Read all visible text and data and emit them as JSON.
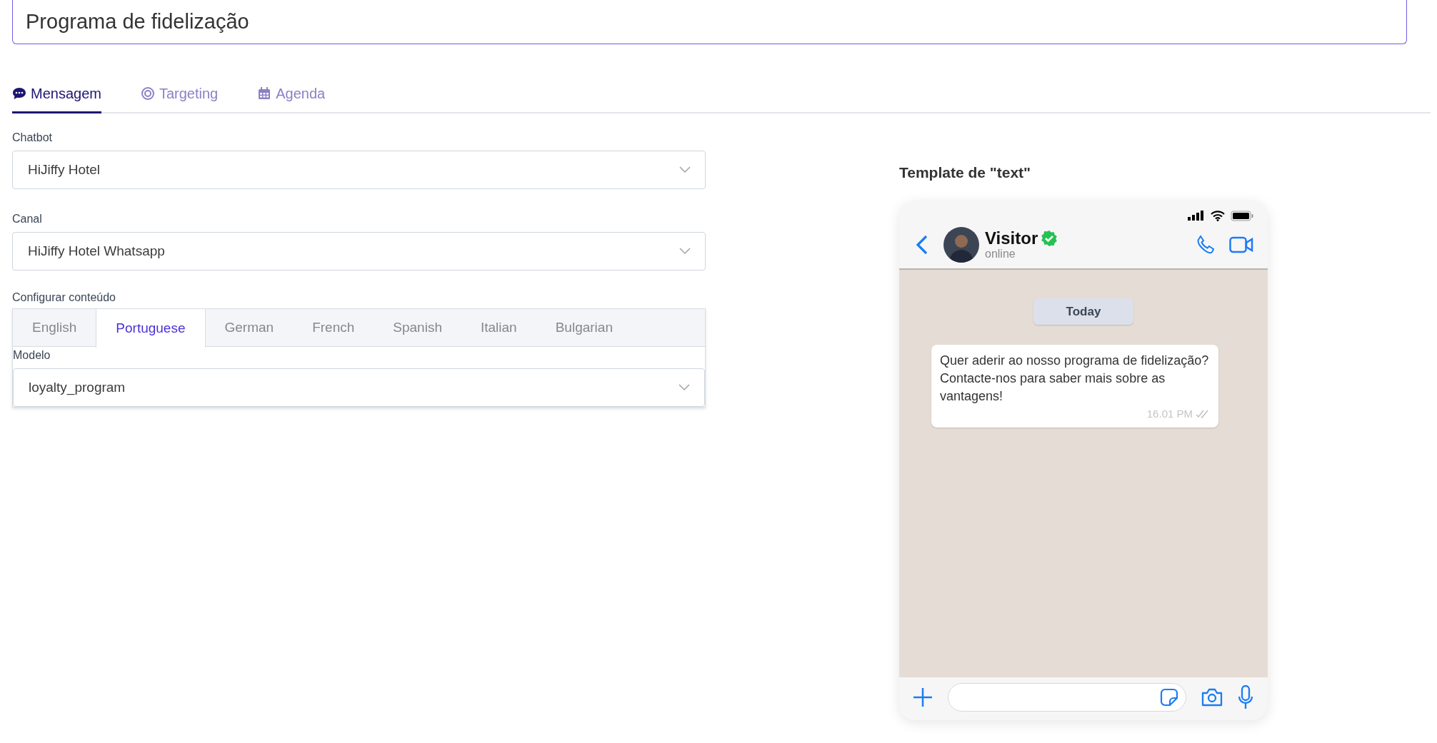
{
  "title_field": {
    "value": "Programa de fidelização"
  },
  "tabs": [
    {
      "label": "Mensagem",
      "selected": true
    },
    {
      "label": "Targeting",
      "selected": false
    },
    {
      "label": "Agenda",
      "selected": false
    }
  ],
  "form": {
    "chatbot": {
      "label": "Chatbot",
      "value": "HiJiffy Hotel"
    },
    "canal": {
      "label": "Canal",
      "value": "HiJiffy Hotel Whatsapp"
    },
    "content": {
      "label": "Configurar conteúdo",
      "languages": [
        {
          "label": "English",
          "selected": false
        },
        {
          "label": "Portuguese",
          "selected": true
        },
        {
          "label": "German",
          "selected": false
        },
        {
          "label": "French",
          "selected": false
        },
        {
          "label": "Spanish",
          "selected": false
        },
        {
          "label": "Italian",
          "selected": false
        },
        {
          "label": "Bulgarian",
          "selected": false
        }
      ],
      "modelo": {
        "label": "Modelo",
        "value": "loyalty_program"
      }
    }
  },
  "preview": {
    "title": "Template de \"text\"",
    "contact": {
      "name": "Visitor",
      "verified": true,
      "status": "online"
    },
    "day": "Today",
    "message": {
      "text": "Quer aderir ao nosso programa de fidelização? Contacte-nos para saber mais sobre as vantagens!",
      "time": "16.01 PM"
    }
  }
}
